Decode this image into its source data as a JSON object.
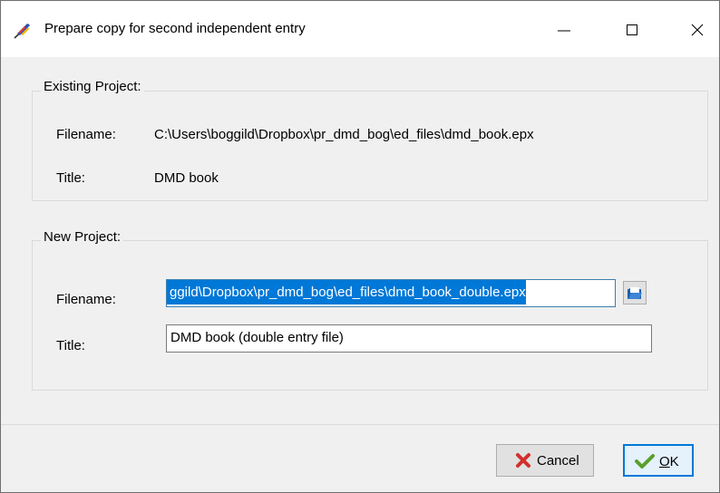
{
  "window": {
    "title": "Prepare copy for second independent entry"
  },
  "existing": {
    "legend": "Existing Project:",
    "filename_label": "Filename:",
    "filename_value": "C:\\Users\\boggild\\Dropbox\\pr_dmd_bog\\ed_files\\dmd_book.epx",
    "title_label": "Title:",
    "title_value": "DMD book"
  },
  "new_project": {
    "legend": "New Project:",
    "filename_label": "Filename:",
    "filename_value": "ggild\\Dropbox\\pr_dmd_bog\\ed_files\\dmd_book_double.epx",
    "title_label": "Title:",
    "title_value": "DMD book (double entry file)"
  },
  "buttons": {
    "cancel_label": "Cancel",
    "ok_mnemonic": "O",
    "ok_rest": "K"
  },
  "colors": {
    "selection": "#0078d7",
    "cancel_icon": "#d32f2f",
    "ok_icon": "#5aa02c"
  },
  "icons": {
    "app": "quill-pen-icon",
    "browse": "open-folder-icon",
    "cancel": "red-x-icon",
    "ok": "green-check-icon"
  }
}
